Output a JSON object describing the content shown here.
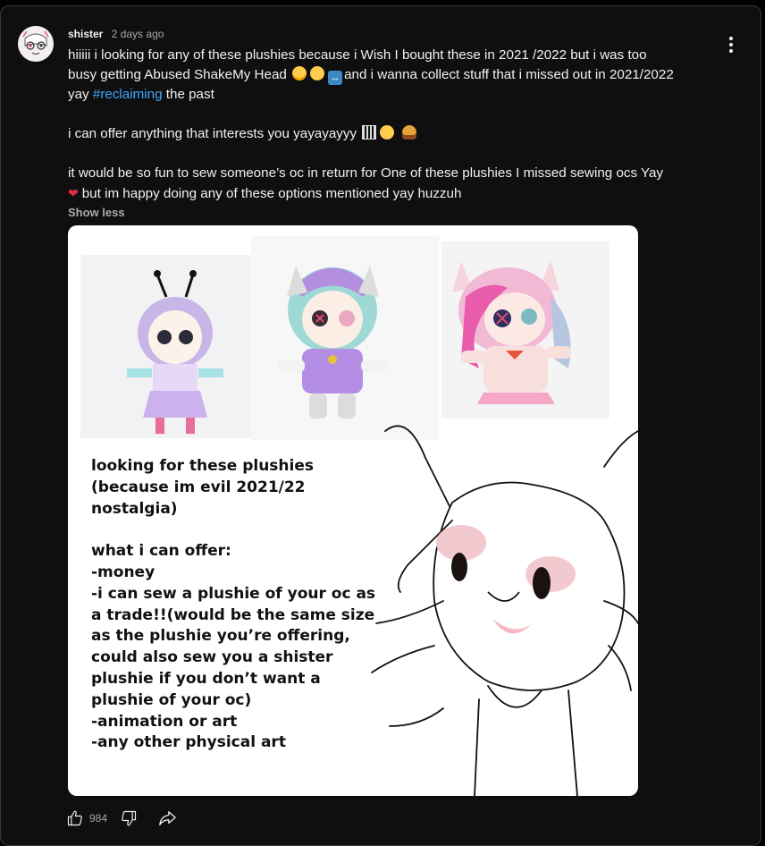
{
  "comment": {
    "author": "shister",
    "time": "2 days ago",
    "lines": [
      "hiiiii i looking for any of these plushies because i Wish I bought these in 2021 /2022 but i was too",
      "busy getting Abused ShakeMy Head",
      "and i wanna collect stuff that i missed out in 2021/2022",
      "yay",
      "#reclaiming",
      "the past",
      "i can offer anything that interests you yayayayyy",
      "it would be so fun to sew someone’s oc in return for One of these plushies I missed sewing ocs Yay",
      "but im happy doing any of these options mentioned yay huzzuh"
    ],
    "show_less": "Show less",
    "likes": "984"
  },
  "image_text": [
    "looking for these plushies",
    "(because im evil 2021/22",
    "nostalgia)",
    "",
    "what i can offer:",
    "-money",
    "-i can sew a plushie of your oc as",
    "a trade!!(would be the same size",
    "as the plushie you’re offering,",
    "could also sew you a shister",
    "plushie if you don’t want a",
    "plushie of your oc)",
    "-animation or art",
    "-any other physical art"
  ],
  "icons": {
    "menu": "vertical-dots-icon",
    "like": "thumbs-up-icon",
    "dislike": "thumbs-down-icon",
    "share": "share-icon"
  },
  "colors": {
    "background": "#0f0f0f",
    "hashtag": "#3ea6ff",
    "muted": "#aaaaaa"
  }
}
